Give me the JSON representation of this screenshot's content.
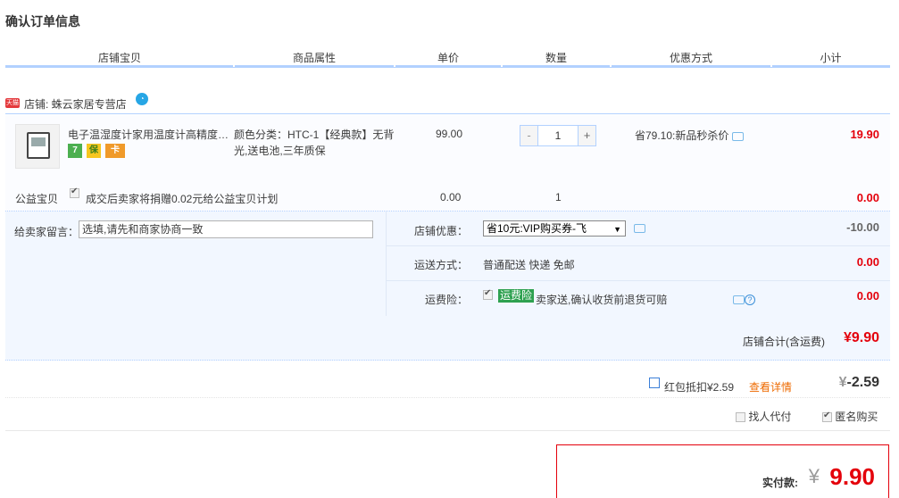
{
  "page_title": "确认订单信息",
  "columns": [
    "店铺宝贝",
    "商品属性",
    "单价",
    "数量",
    "优惠方式",
    "小计"
  ],
  "shop": {
    "badge": "天猫",
    "label": "店铺: 蛛云家居专营店",
    "wang_icon": "wangwang-icon"
  },
  "item": {
    "name": "电子温湿度计家用温度计高精度…",
    "service_icons": [
      "7",
      "保",
      "卡"
    ],
    "attributes": "颜色分类：HTC-1【经典款】无背光,送电池,三年质保",
    "price": "99.00",
    "qty_minus": "-",
    "quantity": "1",
    "qty_plus": "+",
    "discount": "省79.10:新品秒杀价",
    "subtotal": "19.90"
  },
  "charity": {
    "label": "公益宝贝",
    "text": "成交后卖家将捐赠0.02元给公益宝贝计划",
    "price": "0.00",
    "quantity": "1",
    "subtotal": "0.00"
  },
  "message": {
    "label": "给卖家留言：",
    "placeholder": "选填,请先和商家协商一致"
  },
  "shop_discount": {
    "label": "店铺优惠：",
    "selected": "省10元:VIP购买券-飞",
    "value": "-10.00"
  },
  "shipping": {
    "label": "运送方式：",
    "value": "普通配送 快递 免邮",
    "amount": "0.00"
  },
  "insurance": {
    "label": "运费险：",
    "badge": "运费险",
    "text": "卖家送,确认收货前退货可赔",
    "amount": "0.00"
  },
  "shop_total": {
    "label": "店铺合计(含运费)",
    "value": "¥9.90"
  },
  "hongbao": {
    "label": "红包抵扣¥2.59",
    "detail": "查看详情",
    "yen": "¥",
    "value": "-2.59"
  },
  "options": {
    "proxy_pay": "找人代付",
    "anonymous": "匿名购买"
  },
  "payment": {
    "label": "实付款:",
    "yen": "¥",
    "value": "9.90"
  }
}
